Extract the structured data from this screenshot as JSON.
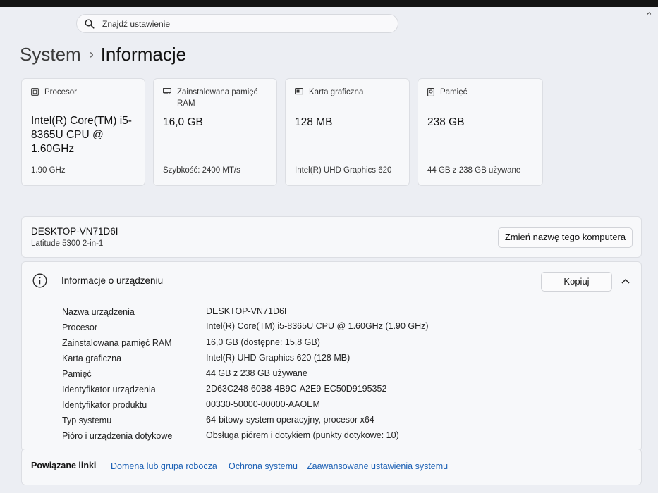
{
  "search": {
    "placeholder": "Znajdź ustawienie"
  },
  "breadcrumb": {
    "parent": "System",
    "separator": "›",
    "current": "Informacje"
  },
  "cards": [
    {
      "title": "Procesor",
      "value": "Intel(R) Core(TM) i5-8365U CPU @ 1.60GHz",
      "sub": "1.90 GHz",
      "icon": "cpu-icon"
    },
    {
      "title": "Zainstalowana pamięć RAM",
      "value": "16,0 GB",
      "sub": "Szybkość: 2400 MT/s",
      "icon": "ram-icon"
    },
    {
      "title": "Karta graficzna",
      "value": "128 MB",
      "sub": "Intel(R) UHD Graphics 620",
      "icon": "gpu-icon"
    },
    {
      "title": "Pamięć",
      "value": "238 GB",
      "sub": "44 GB z 238 GB używane",
      "icon": "storage-icon"
    }
  ],
  "device": {
    "name": "DESKTOP-VN71D6I",
    "model": "Latitude 5300 2-in-1",
    "rename_button": "Zmień nazwę tego komputera"
  },
  "specs": {
    "title": "Informacje o urządzeniu",
    "copy_button": "Kopiuj",
    "rows": [
      {
        "label": "Nazwa urządzenia",
        "value": "DESKTOP-VN71D6I"
      },
      {
        "label": "Procesor",
        "value": "Intel(R) Core(TM) i5-8365U CPU @ 1.60GHz (1.90 GHz)"
      },
      {
        "label": "Zainstalowana pamięć RAM",
        "value": "16,0 GB (dostępne: 15,8 GB)"
      },
      {
        "label": "Karta graficzna",
        "value": "Intel(R) UHD Graphics 620 (128 MB)"
      },
      {
        "label": "Pamięć",
        "value": "44 GB z 238 GB używane"
      },
      {
        "label": "Identyfikator urządzenia",
        "value": "2D63C248-60B8-4B9C-A2E9-EC50D9195352"
      },
      {
        "label": "Identyfikator produktu",
        "value": "00330-50000-00000-AAOEM"
      },
      {
        "label": "Typ systemu",
        "value": "64-bitowy system operacyjny, procesor x64"
      },
      {
        "label": "Pióro i urządzenia dotykowe",
        "value": "Obsługa piórem i dotykiem (punkty dotykowe: 10)"
      }
    ]
  },
  "related": {
    "title": "Powiązane linki",
    "links": [
      "Domena lub grupa robocza",
      "Ochrona systemu",
      "Zaawansowane ustawienia systemu"
    ]
  },
  "colors": {
    "accent": "#1a5fb4",
    "background": "#eceef3",
    "card": "#f7f8fa"
  }
}
